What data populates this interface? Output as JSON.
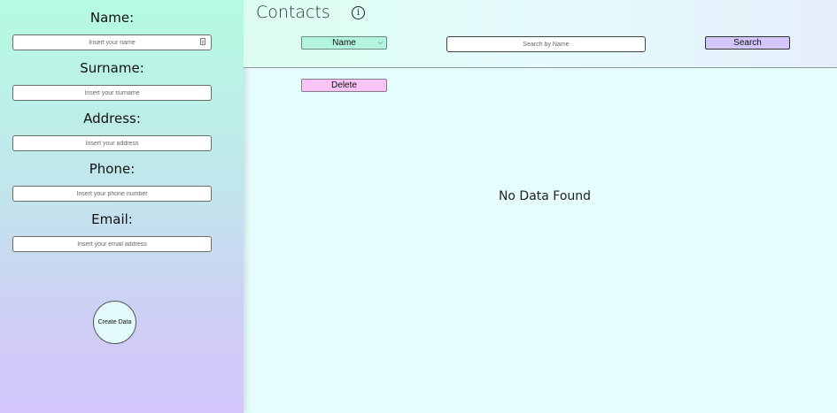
{
  "form": {
    "fields": [
      {
        "label": "Name:",
        "placeholder": "Insert your name"
      },
      {
        "label": "Surname:",
        "placeholder": "Insert your surname"
      },
      {
        "label": "Address:",
        "placeholder": "Insert your address"
      },
      {
        "label": "Phone:",
        "placeholder": "Insert your phone number"
      },
      {
        "label": "Email:",
        "placeholder": "Insert your email address"
      }
    ],
    "create_label": "Create Data"
  },
  "header": {
    "title": "Contacts",
    "info_glyph": "i",
    "info_icon": "info-icon"
  },
  "toolbar": {
    "filter_selected": "Name",
    "search_placeholder": "Search by Name",
    "search_label": "Search",
    "delete_label": "Delete"
  },
  "content": {
    "empty_message": "No Data Found"
  },
  "colors": {
    "sidebar_top": "#b5fbe2",
    "sidebar_bottom": "#d3c6fb",
    "main_bg": "#e6fdfd",
    "select_bg": "#b3f5dc",
    "search_button": "#d3c6fb",
    "delete_button": "#f7c4f5"
  }
}
